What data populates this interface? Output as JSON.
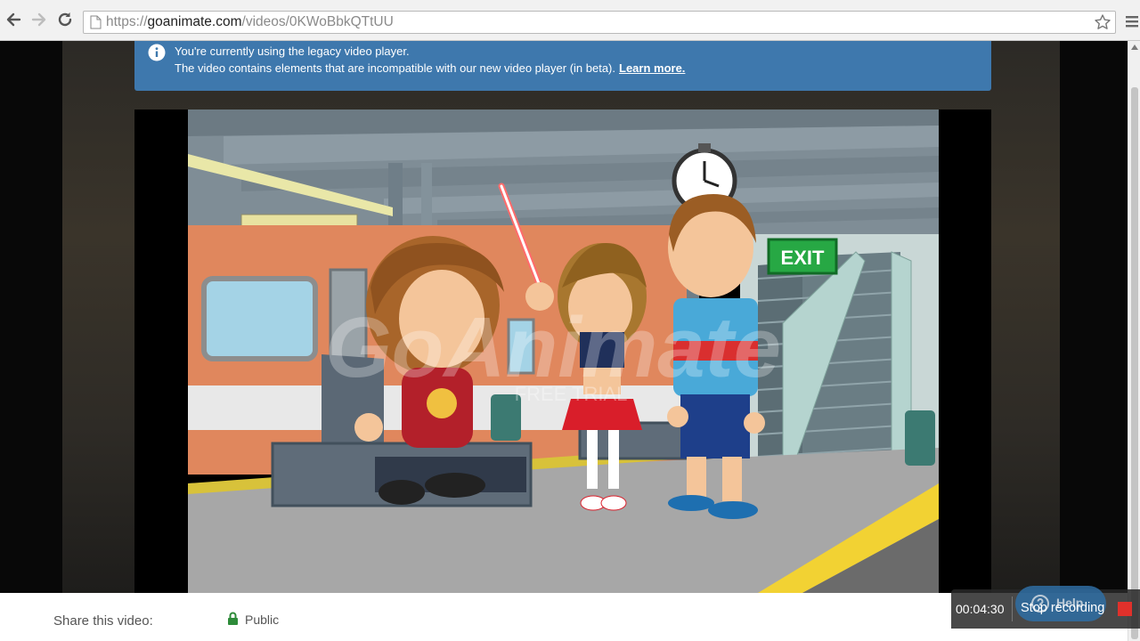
{
  "browser": {
    "url_scheme": "https://",
    "url_host": "goanimate.com",
    "url_path": "/videos/0KWoBbkQTtUU"
  },
  "notice": {
    "line1": "You're currently using the legacy video player.",
    "line2": "The video contains elements that are incompatible with our new video player (in beta).",
    "link": "Learn more."
  },
  "video": {
    "watermark": "GoAnimate",
    "watermark_sub": "FREE TRIAL",
    "exit_sign": "EXIT"
  },
  "sharebar": {
    "share_label": "Share this video:",
    "privacy": "Public"
  },
  "recording": {
    "help_label": "Help",
    "timer": "00:04:30",
    "stop_label": "Stop recording"
  },
  "colors": {
    "notice_bg": "#3e78ad",
    "stop_red": "#e0312b",
    "exit_green": "#27a844"
  }
}
